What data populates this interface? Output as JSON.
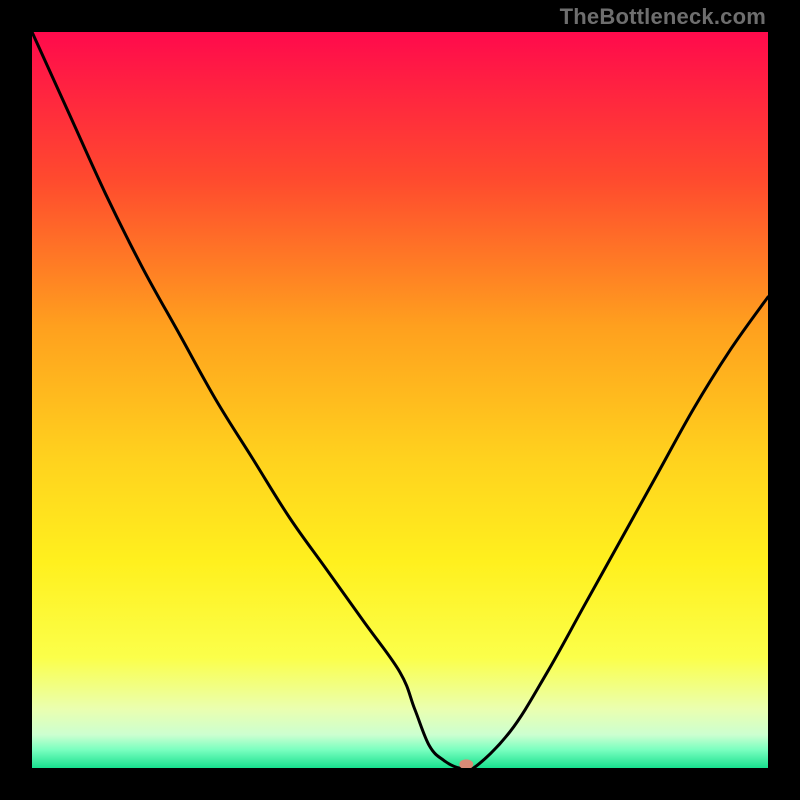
{
  "watermark": "TheBottleneck.com",
  "chart_data": {
    "type": "line",
    "title": "",
    "xlabel": "",
    "ylabel": "",
    "xlim": [
      0,
      100
    ],
    "ylim": [
      0,
      100
    ],
    "x": [
      0,
      5,
      10,
      15,
      20,
      25,
      30,
      35,
      40,
      45,
      50,
      52,
      54,
      56,
      58,
      60,
      65,
      70,
      75,
      80,
      85,
      90,
      95,
      100
    ],
    "values": [
      100,
      89,
      78,
      68,
      59,
      50,
      42,
      34,
      27,
      20,
      13,
      8,
      3,
      1,
      0,
      0,
      5,
      13,
      22,
      31,
      40,
      49,
      57,
      64
    ],
    "minimum_x": 58,
    "gradient_stops": [
      {
        "pos": 0.0,
        "color": "#ff0a4c"
      },
      {
        "pos": 0.2,
        "color": "#ff4a2e"
      },
      {
        "pos": 0.4,
        "color": "#ffa01e"
      },
      {
        "pos": 0.58,
        "color": "#ffd21e"
      },
      {
        "pos": 0.72,
        "color": "#fff01e"
      },
      {
        "pos": 0.85,
        "color": "#fbff4a"
      },
      {
        "pos": 0.92,
        "color": "#eaffb0"
      },
      {
        "pos": 0.955,
        "color": "#ccffd0"
      },
      {
        "pos": 0.975,
        "color": "#7bffc0"
      },
      {
        "pos": 1.0,
        "color": "#18e08e"
      }
    ],
    "marker": {
      "x": 59,
      "y": 0.5,
      "color": "#d98b77",
      "rx": 7,
      "ry": 5
    }
  }
}
